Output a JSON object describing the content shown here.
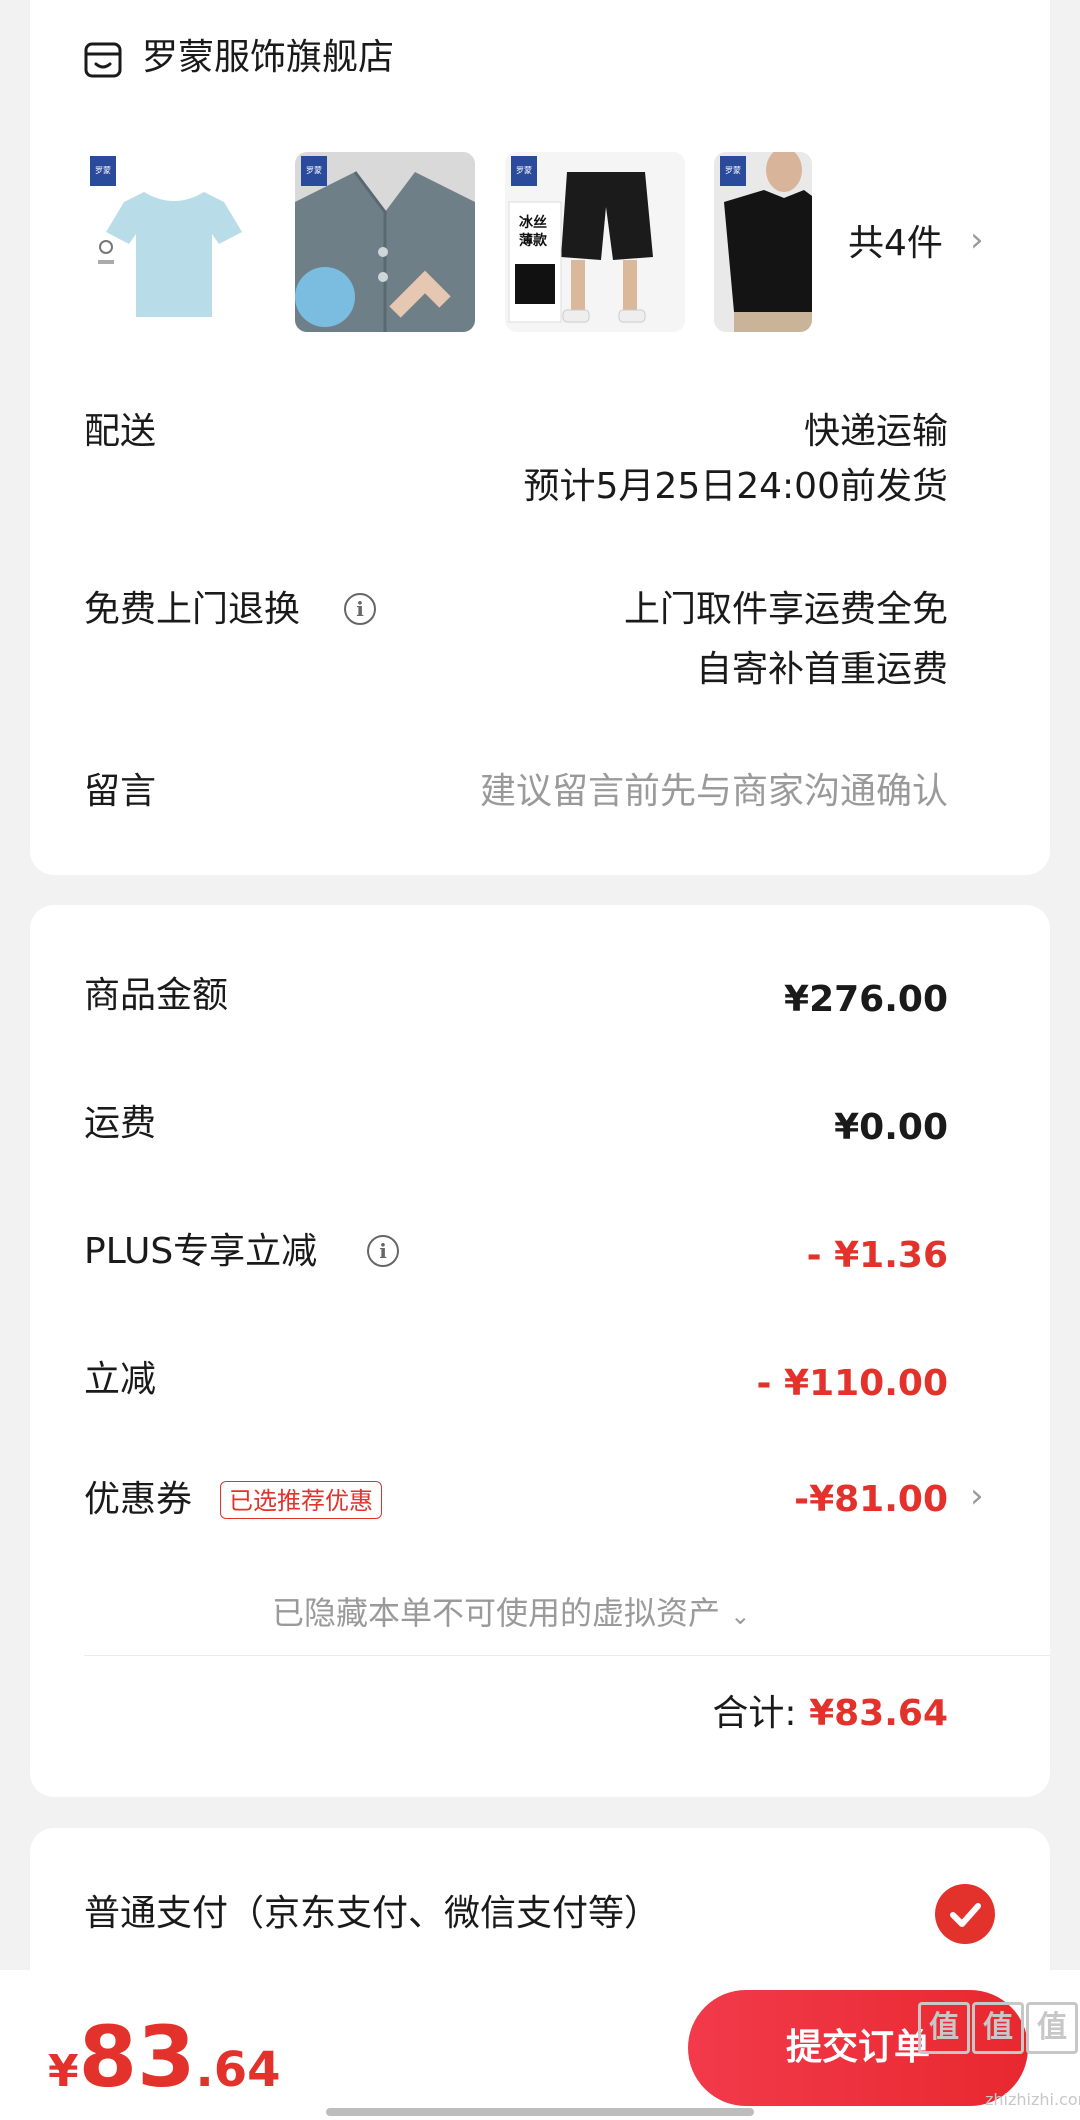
{
  "store": {
    "icon": "store-icon",
    "name": "罗蒙服饰旗舰店",
    "items": [
      {
        "name": "light-blue t-shirt",
        "icon": "tshirt-light-blue"
      },
      {
        "name": "grey polo shirt",
        "icon": "polo-grey"
      },
      {
        "name": "black shorts",
        "icon": "shorts-black",
        "caption": "冰丝薄款"
      },
      {
        "name": "black t-shirt",
        "icon": "tshirt-black"
      }
    ],
    "brand_tag": "罗蒙",
    "count_label": "共4件"
  },
  "delivery": {
    "label": "配送",
    "method": "快递运输",
    "estimate": "预计5月25日24:00前发货"
  },
  "free_return": {
    "label": "免费上门退换",
    "line1": "上门取件享运费全免",
    "line2": "自寄补首重运费"
  },
  "message": {
    "label": "留言",
    "placeholder": "建议留言前先与商家沟通确认"
  },
  "amount": {
    "goods_label": "商品金额",
    "goods_value": "¥276.00",
    "shipping_label": "运费",
    "shipping_value": "¥0.00",
    "plus_label": "PLUS专享立减",
    "plus_value": "- ¥1.36",
    "discount_label": "立减",
    "discount_value": "- ¥110.00",
    "coupon_label": "优惠券",
    "coupon_badge": "已选推荐优惠",
    "coupon_value": "-¥81.00",
    "hidden_assets": "已隐藏本单不可使用的虚拟资产",
    "total_label": "合计:",
    "total_value": "¥83.64"
  },
  "payment": {
    "option_label": "普通支付（京东支付、微信支付等）",
    "selected": true
  },
  "bottom": {
    "currency": "¥",
    "price_int": "83",
    "price_dec": ".64",
    "submit_label": "提交订单"
  },
  "watermark": {
    "chars": [
      "值",
      "值",
      "值"
    ],
    "text": "zhizhizhi.com"
  },
  "colors": {
    "accent_red": "#e3322b",
    "background": "#f2f2f2"
  }
}
